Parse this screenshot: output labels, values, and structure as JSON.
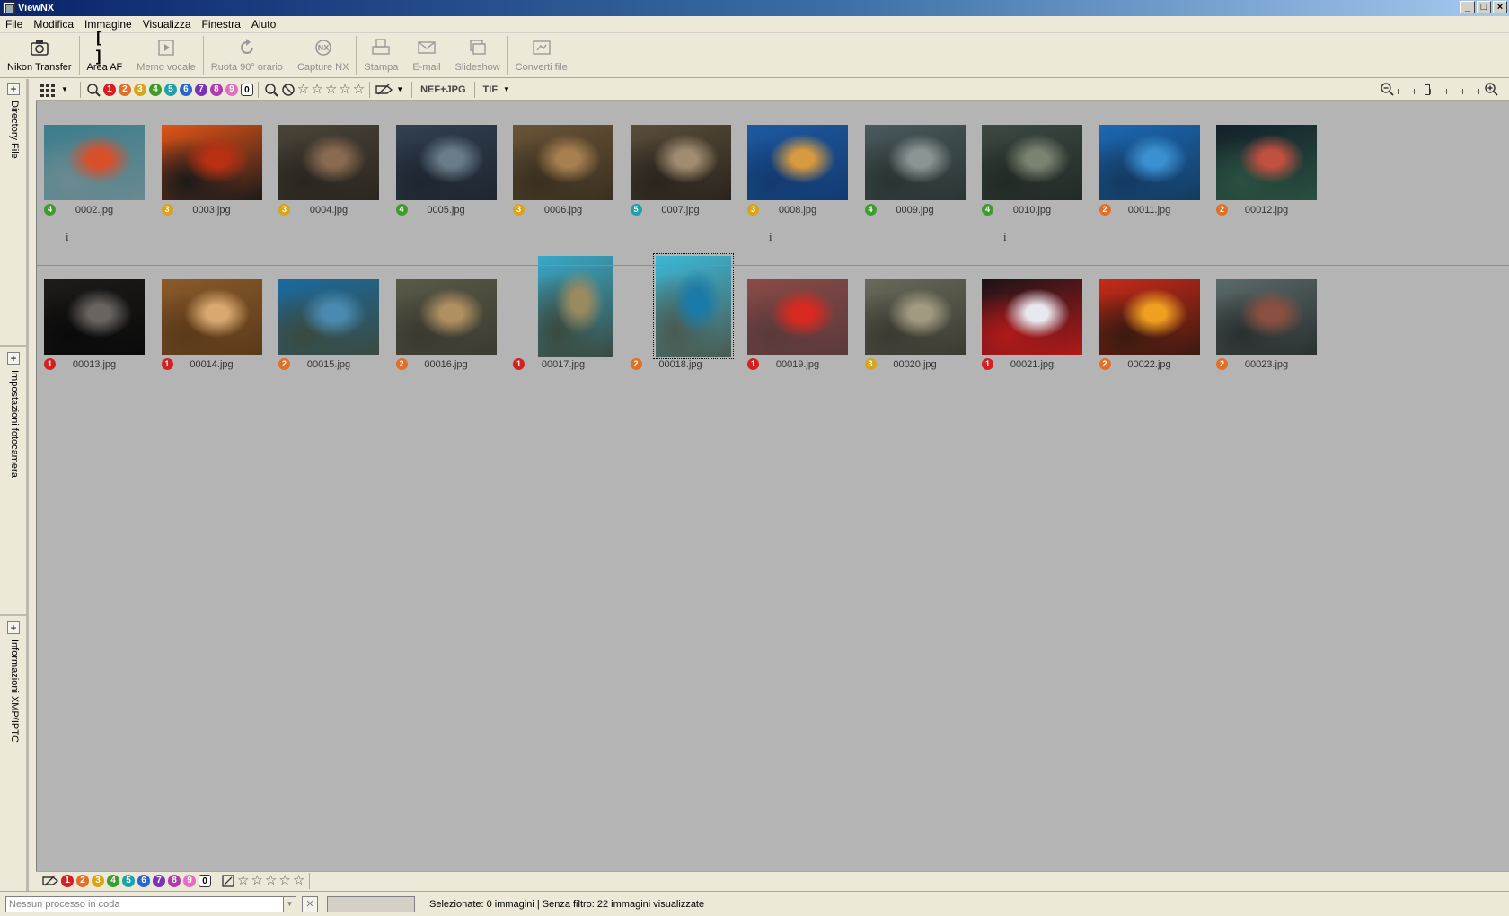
{
  "window": {
    "title": "ViewNX"
  },
  "menu": [
    "File",
    "Modifica",
    "Immagine",
    "Visualizza",
    "Finestra",
    "Aiuto"
  ],
  "toolbar": [
    {
      "label": "Nikon Transfer",
      "icon": "camera-icon",
      "enabled": true
    },
    {
      "label": "Area AF",
      "icon": "af-area-icon",
      "enabled": true
    },
    {
      "label": "Memo vocale",
      "icon": "voice-memo-icon",
      "enabled": false
    },
    {
      "label": "Ruota 90° orario",
      "icon": "rotate-icon",
      "enabled": false
    },
    {
      "label": "Capture NX",
      "icon": "capture-nx-icon",
      "enabled": false
    },
    {
      "label": "Stampa",
      "icon": "print-icon",
      "enabled": false
    },
    {
      "label": "E-mail",
      "icon": "email-icon",
      "enabled": false
    },
    {
      "label": "Slideshow",
      "icon": "slideshow-icon",
      "enabled": false
    },
    {
      "label": "Converti file",
      "icon": "convert-icon",
      "enabled": false
    }
  ],
  "side_panels": [
    "Directory File",
    "Impostazioni fotocamera",
    "Informazioni XMP/IPTC"
  ],
  "label_colors": {
    "1": "#d42020",
    "2": "#e07028",
    "3": "#d9a516",
    "4": "#3e9c2e",
    "5": "#1ea2a8",
    "6": "#2a66cc",
    "7": "#7a32b8",
    "8": "#b03ab0",
    "9": "#e070c0",
    "0": "#ffffff"
  },
  "label_filters": [
    "1",
    "2",
    "3",
    "4",
    "5",
    "6",
    "7",
    "8",
    "9",
    "0"
  ],
  "format_filters": [
    "NEF+JPG",
    "TIF"
  ],
  "thumbnails": [
    {
      "name": "0002.jpg",
      "label": "4",
      "colors": [
        "#3b7c8c",
        "#d8502a",
        "#6a8a90"
      ],
      "info": true
    },
    {
      "name": "0003.jpg",
      "label": "3",
      "colors": [
        "#e25418",
        "#b83012",
        "#1a1a1a"
      ],
      "info": false
    },
    {
      "name": "0004.jpg",
      "label": "3",
      "colors": [
        "#4a4438",
        "#8a6a50",
        "#2a2620"
      ],
      "info": false
    },
    {
      "name": "0005.jpg",
      "label": "4",
      "colors": [
        "#324050",
        "#6a7c8a",
        "#1e2630"
      ],
      "info": false
    },
    {
      "name": "0006.jpg",
      "label": "3",
      "colors": [
        "#6a5438",
        "#a88050",
        "#3a3020"
      ],
      "info": false
    },
    {
      "name": "0007.jpg",
      "label": "5",
      "colors": [
        "#5a4e3a",
        "#a08c70",
        "#2a241c"
      ],
      "info": false
    },
    {
      "name": "0008.jpg",
      "label": "3",
      "colors": [
        "#1e5aa0",
        "#d89a40",
        "#123a70"
      ],
      "info": true
    },
    {
      "name": "0009.jpg",
      "label": "4",
      "colors": [
        "#4a5a5c",
        "#8a9694",
        "#2a3434"
      ],
      "info": false
    },
    {
      "name": "0010.jpg",
      "label": "4",
      "colors": [
        "#3c4a42",
        "#7a8270",
        "#222a26"
      ],
      "info": true
    },
    {
      "name": "00011.jpg",
      "label": "2",
      "colors": [
        "#1c68b4",
        "#3a90d0",
        "#143a60"
      ],
      "info": false
    },
    {
      "name": "00012.jpg",
      "label": "2",
      "colors": [
        "#12202a",
        "#c05040",
        "#2a5040"
      ],
      "info": false
    },
    {
      "name": "00013.jpg",
      "label": "1",
      "colors": [
        "#1e1c1a",
        "#6a6460",
        "#0a0a0a"
      ],
      "info": false
    },
    {
      "name": "00014.jpg",
      "label": "1",
      "colors": [
        "#8a5a2a",
        "#d8a870",
        "#5a3a1a"
      ],
      "info": false
    },
    {
      "name": "00015.jpg",
      "label": "2",
      "colors": [
        "#1a6aa0",
        "#4a8ab0",
        "#3a4a40"
      ],
      "info": false
    },
    {
      "name": "00016.jpg",
      "label": "2",
      "colors": [
        "#5a5a48",
        "#b09060",
        "#3a3a30"
      ],
      "info": false
    },
    {
      "name": "00017.jpg",
      "label": "1",
      "colors": [
        "#38a8c8",
        "#9a8a60",
        "#3a4a40"
      ],
      "info": false,
      "portrait": true
    },
    {
      "name": "00018.jpg",
      "label": "2",
      "colors": [
        "#3ab8d8",
        "#1a7aa8",
        "#4a5a50"
      ],
      "info": false,
      "portrait": true,
      "selected": true
    },
    {
      "name": "00019.jpg",
      "label": "1",
      "colors": [
        "#8a4a48",
        "#d82a20",
        "#5a3a3a"
      ],
      "info": false
    },
    {
      "name": "00020.jpg",
      "label": "3",
      "colors": [
        "#6a6a5a",
        "#a09a80",
        "#3a3a32"
      ],
      "info": false
    },
    {
      "name": "00021.jpg",
      "label": "1",
      "colors": [
        "#1a1418",
        "#e8e8f0",
        "#b01a1a"
      ],
      "info": false
    },
    {
      "name": "00022.jpg",
      "label": "2",
      "colors": [
        "#c82a1a",
        "#f0a020",
        "#3a1a10"
      ],
      "info": false
    },
    {
      "name": "00023.jpg",
      "label": "2",
      "colors": [
        "#5a6a6a",
        "#8a5040",
        "#2a3030"
      ],
      "info": false
    }
  ],
  "status": {
    "queue_placeholder": "Nessun processo in coda",
    "text": "Selezionate: 0 immagini | Senza filtro: 22 immagini visualizzate"
  }
}
